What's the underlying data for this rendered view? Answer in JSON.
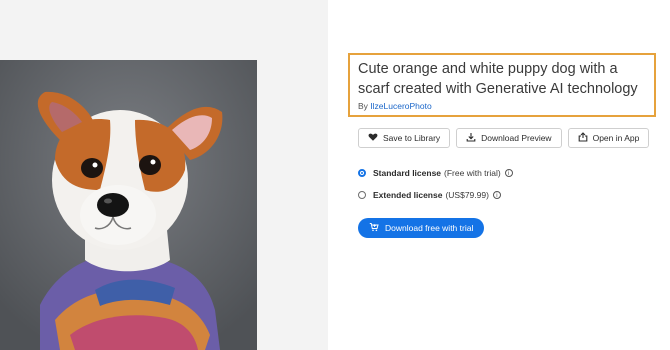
{
  "asset": {
    "title": "Cute orange and white puppy dog with a scarf created with Generative AI technology",
    "by_label": "By",
    "author": "IlzeLuceroPhoto"
  },
  "actions": [
    {
      "label": "Save to Library",
      "icon": "heart-icon"
    },
    {
      "label": "Download Preview",
      "icon": "download-icon"
    },
    {
      "label": "Open in App",
      "icon": "open-in-app-icon"
    }
  ],
  "licenses": [
    {
      "name": "Standard license",
      "note": "(Free with trial)",
      "selected": true
    },
    {
      "name": "Extended license",
      "note": "(US$79.99)",
      "selected": false
    }
  ],
  "download_button": {
    "label": "Download free with trial",
    "icon": "cart-icon"
  },
  "colors": {
    "accent": "#1473e6",
    "highlight_border": "#e6a23c",
    "image_background": "#5f6368"
  }
}
